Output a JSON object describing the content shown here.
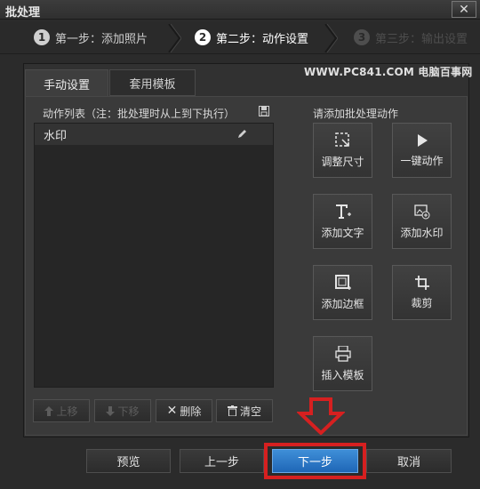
{
  "window": {
    "title": "批处理"
  },
  "steps": [
    {
      "num": "1",
      "label": "第一步：添加照片",
      "state": "done"
    },
    {
      "num": "2",
      "label": "第二步：动作设置",
      "state": "active"
    },
    {
      "num": "3",
      "label": "第三步：输出设置",
      "state": "future"
    }
  ],
  "watermark": "WWW.PC841.COM 电脑百事网",
  "tabs": {
    "manual": "手动设置",
    "template": "套用模板"
  },
  "action_list": {
    "header": "动作列表（注：批处理时从上到下执行）",
    "items": [
      "水印"
    ]
  },
  "list_buttons": {
    "up": "上移",
    "down": "下移",
    "delete": "删除",
    "clear": "清空"
  },
  "actions": {
    "header": "请添加批处理动作",
    "resize": "调整尺寸",
    "one_click": "一键动作",
    "add_text": "添加文字",
    "add_watermark": "添加水印",
    "add_border": "添加边框",
    "crop": "裁剪",
    "insert_template": "插入模板"
  },
  "footer": {
    "preview": "预览",
    "prev": "上一步",
    "next": "下一步",
    "cancel": "取消"
  },
  "colors": {
    "primary": "#2a78c8",
    "highlight": "#d62020",
    "background": "#2b2b2b"
  }
}
